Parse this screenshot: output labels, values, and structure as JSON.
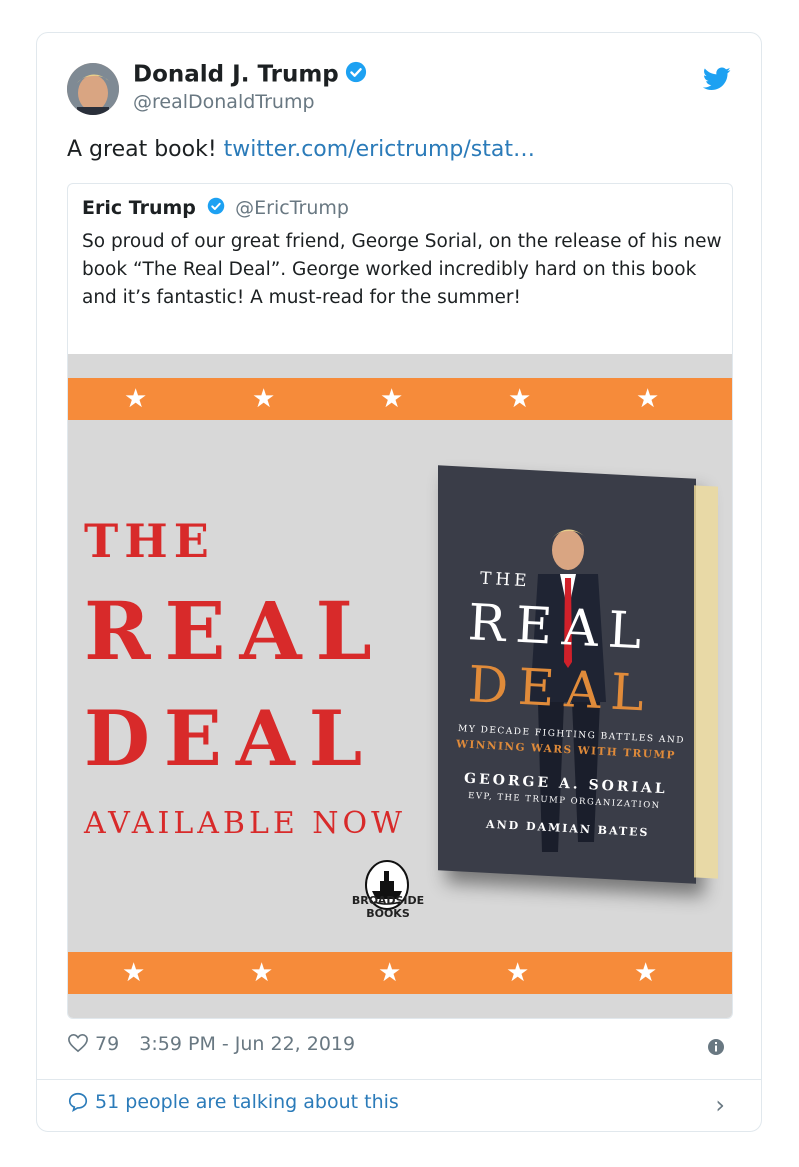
{
  "author": {
    "name": "Donald J. Trump",
    "handle": "@realDonaldTrump"
  },
  "tweet": {
    "text": "A great book! ",
    "link_text": "twitter.com/erictrump/stat…"
  },
  "quoted": {
    "name": "Eric Trump",
    "handle": "@EricTrump",
    "text": "So proud of our great friend, George Sorial, on the release of his new book “The Real Deal”. George worked incredibly hard on this book and it’s fantastic! A must-read for the summer!"
  },
  "promo": {
    "title_line1": "THE",
    "title_line2": "REAL",
    "title_line3": "DEAL",
    "available": "AVAILABLE NOW",
    "publisher": "BROADSIDE BOOKS",
    "book": {
      "the": "THE",
      "real": "REAL",
      "deal": "DEAL",
      "subtitle1": "MY DECADE FIGHTING BATTLES AND",
      "subtitle2": "WINNING WARS WITH TRUMP",
      "author": "GEORGE A. SORIAL",
      "author_title": "EVP, THE TRUMP ORGANIZATION",
      "coauthor": "AND DAMIAN BATES"
    }
  },
  "footer": {
    "likes": "79",
    "timestamp": "3:59 PM - Jun 22, 2019",
    "talking": "51 people are talking about this"
  },
  "colors": {
    "link": "#2b7bb9",
    "verified": "#1da1f2",
    "stripe": "#f68b3a",
    "title_red": "#d82a2a"
  }
}
